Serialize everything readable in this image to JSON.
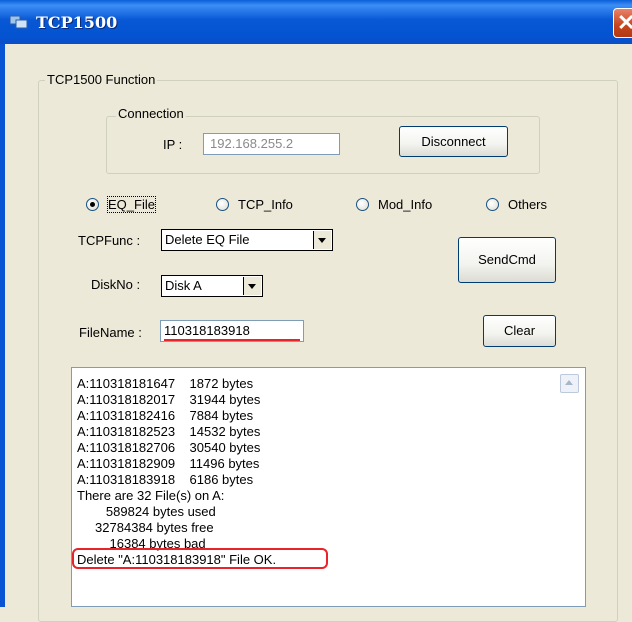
{
  "window": {
    "title": "TCP1500",
    "app_icon": "app-window-icon",
    "close_icon": "close-icon"
  },
  "function_group": {
    "legend": "TCP1500 Function"
  },
  "connection": {
    "legend": "Connection",
    "ip_label": "IP :",
    "ip_value": "192.168.255.2",
    "disconnect_label": "Disconnect"
  },
  "radios": [
    {
      "label": "EQ_File",
      "selected": true
    },
    {
      "label": "TCP_Info",
      "selected": false
    },
    {
      "label": "Mod_Info",
      "selected": false
    },
    {
      "label": "Others",
      "selected": false
    }
  ],
  "tcpfunc": {
    "label": "TCPFunc :",
    "value": "Delete EQ File"
  },
  "diskno": {
    "label": "DiskNo :",
    "value": "Disk A"
  },
  "filename": {
    "label": "FileName :",
    "value": "110318183918"
  },
  "buttons": {
    "sendcmd": "SendCmd",
    "clear": "Clear"
  },
  "output_lines": [
    "A:110318181647    1872 bytes",
    "A:110318182017    31944 bytes",
    "A:110318182416    7884 bytes",
    "A:110318182523    14532 bytes",
    "A:110318182706    30540 bytes",
    "A:110318182909    11496 bytes",
    "A:110318183918    6186 bytes",
    "There are 32 File(s) on A:",
    "        589824 bytes used",
    "     32784384 bytes free",
    "         16384 bytes bad",
    "Delete \"A:110318183918\" File OK."
  ],
  "highlight_color": "#e8232a"
}
